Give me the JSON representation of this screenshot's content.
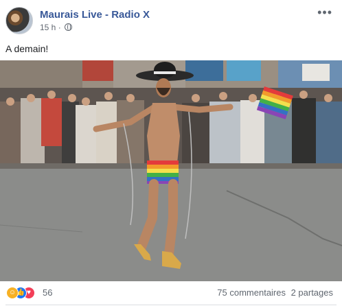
{
  "post": {
    "page_name": "Maurais Live - Radio X",
    "time": "15 h",
    "separator": "·",
    "privacy_icon": "globe-icon",
    "more_icon": "more-horizontal-icon",
    "more_label": "•••",
    "caption": "A demain!"
  },
  "photo": {
    "alt": "Photo"
  },
  "footer": {
    "reaction_icons": [
      "haha-reaction-icon",
      "like-reaction-icon",
      "love-reaction-icon"
    ],
    "reaction_count": "56",
    "comments": "75 commentaires",
    "shares": "2 partages"
  },
  "colors": {
    "page_name": "#385898",
    "meta": "#606770",
    "like": "#2078f4",
    "love": "#f33e58",
    "haha": "#f7b125"
  }
}
